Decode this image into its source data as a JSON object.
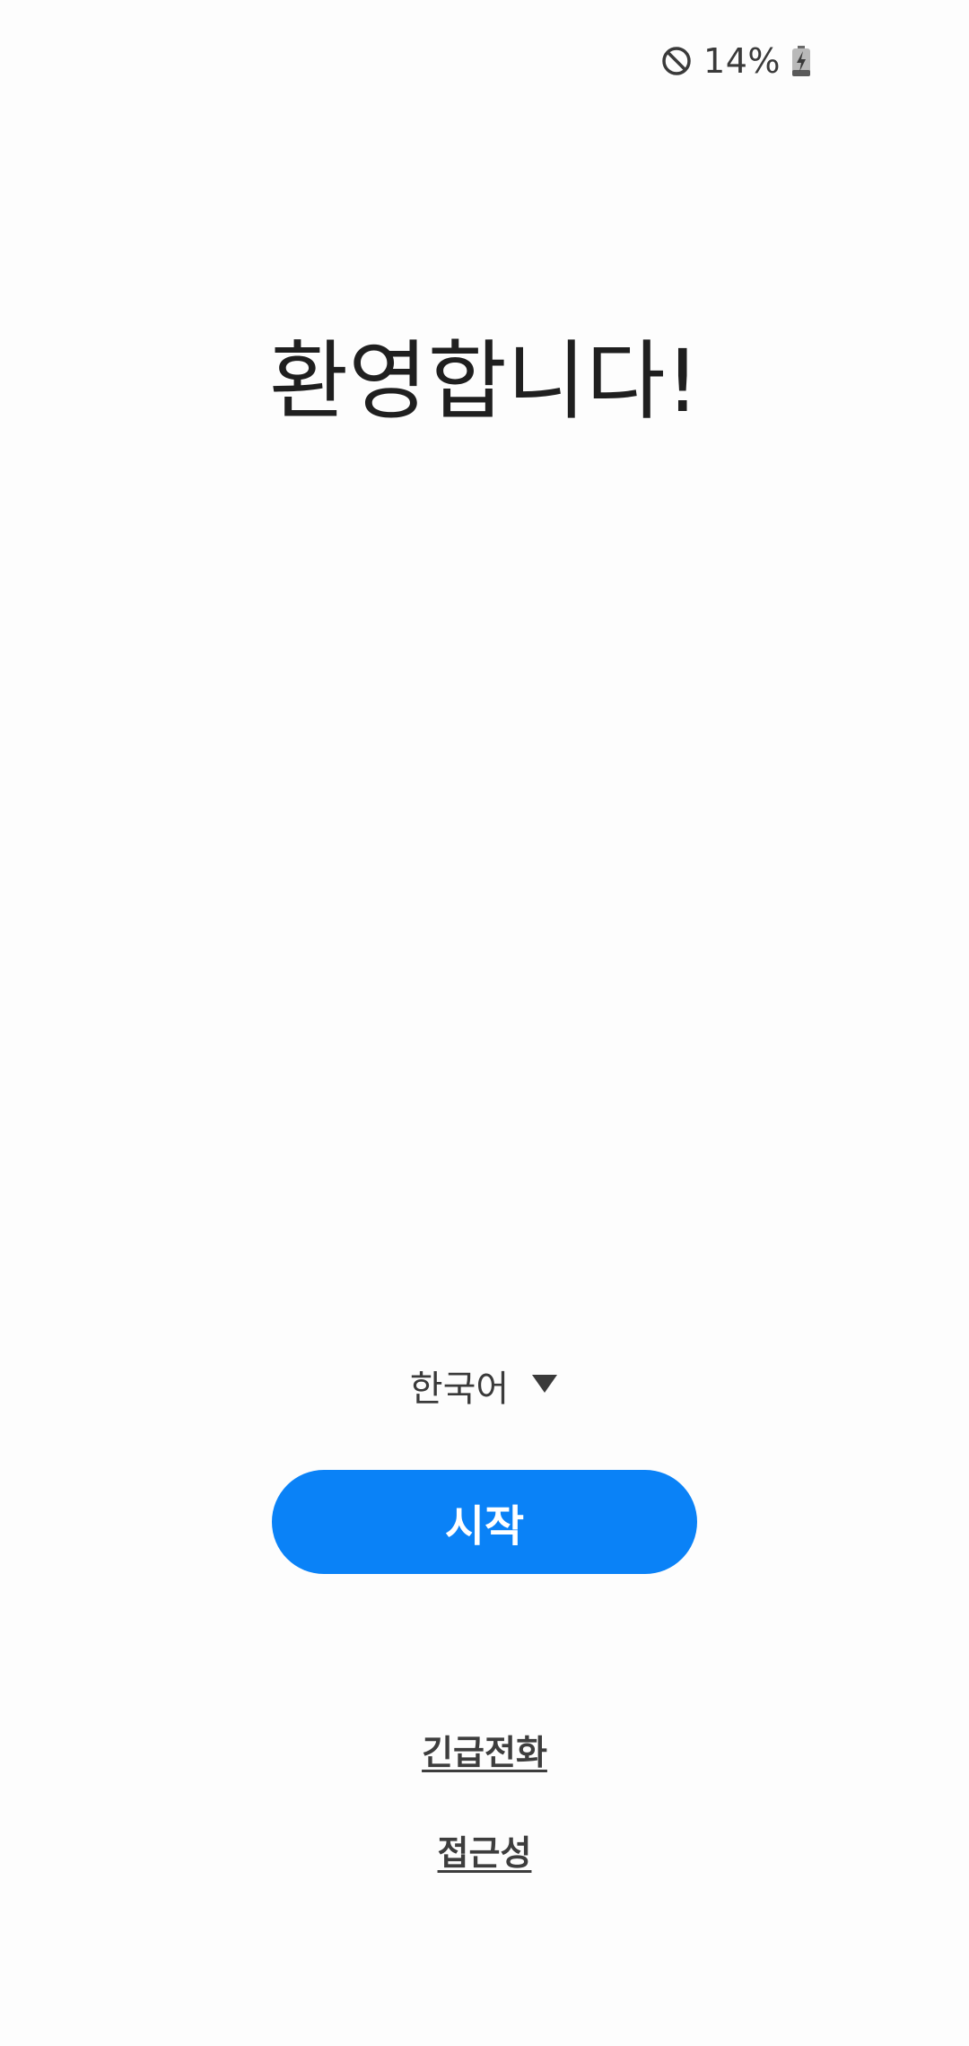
{
  "status_bar": {
    "dnd_icon": "do-not-disturb-icon",
    "battery_percent": "14%",
    "battery_icon": "battery-charging-icon"
  },
  "welcome": {
    "title": "환영합니다!"
  },
  "language": {
    "selected": "한국어",
    "dropdown_icon": "triangle-down-icon"
  },
  "start_button": {
    "label": "시작",
    "color": "#0a82f7"
  },
  "links": {
    "emergency_call": "긴급전화",
    "accessibility": "접근성"
  }
}
